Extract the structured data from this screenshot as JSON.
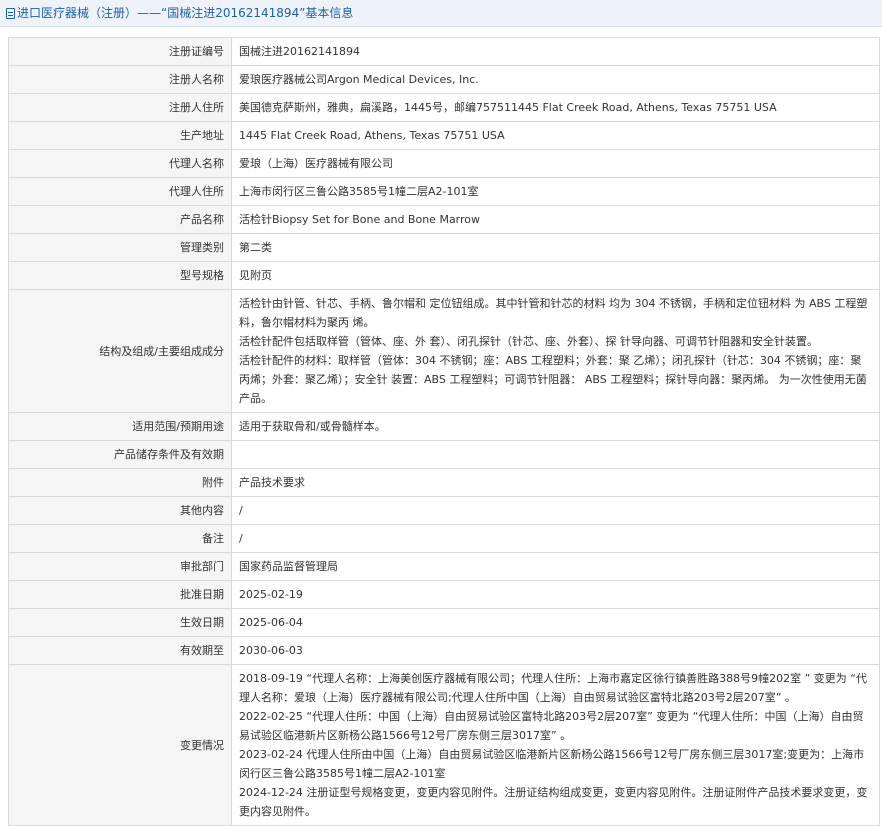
{
  "header": {
    "title": "进口医疗器械（注册）——“国械注进20162141894”基本信息"
  },
  "fields": [
    {
      "label": "注册证编号",
      "value": "国械注进20162141894"
    },
    {
      "label": "注册人名称",
      "value": "爱琅医疗器械公司Argon Medical Devices, Inc."
    },
    {
      "label": "注册人住所",
      "value": "美国德克萨斯州，雅典，扁溪路，1445号，邮编757511445 Flat Creek Road, Athens, Texas 75751 USA"
    },
    {
      "label": "生产地址",
      "value": "1445 Flat Creek Road, Athens, Texas 75751 USA"
    },
    {
      "label": "代理人名称",
      "value": "爱琅（上海）医疗器械有限公司"
    },
    {
      "label": "代理人住所",
      "value": "上海市闵行区三鲁公路3585号1幢二层A2-101室"
    },
    {
      "label": "产品名称",
      "value": "活检针Biopsy Set for Bone and Bone Marrow"
    },
    {
      "label": "管理类别",
      "value": "第二类"
    },
    {
      "label": "型号规格",
      "value": "见附页"
    }
  ],
  "structure": {
    "label": "结构及组成/主要组成成分",
    "lines": [
      "活检针由针管、针芯、手柄、鲁尔帽和 定位钮组成。其中针管和针芯的材料 均为 304 不锈钢，手柄和定位钮材料 为 ABS 工程塑料，鲁尔帽材料为聚丙 烯。",
      "活检针配件包括取样管（管体、座、外 套）、闭孔探针（针芯、座、外套）、探 针导向器、可调节针阻器和安全针装置。",
      "活检针配件的材料：取样管（管体：304 不锈钢；座：ABS 工程塑料；外套：聚 乙烯）；闭孔探针（针芯：304 不锈钢；座：聚丙烯；外套：聚乙烯）；安全针 装置：ABS 工程塑料；可调节针阻器： ABS 工程塑料；探针导向器：聚丙烯。 为一次性使用无菌产品。"
    ]
  },
  "fields2": [
    {
      "label": "适用范围/预期用途",
      "value": "适用于获取骨和/或骨髓样本。"
    },
    {
      "label": "产品储存条件及有效期",
      "value": ""
    },
    {
      "label": "附件",
      "value": "产品技术要求"
    },
    {
      "label": "其他内容",
      "value": "/"
    },
    {
      "label": "备注",
      "value": "/"
    },
    {
      "label": "审批部门",
      "value": "国家药品监督管理局"
    },
    {
      "label": "批准日期",
      "value": "2025-02-19"
    },
    {
      "label": "生效日期",
      "value": "2025-06-04"
    },
    {
      "label": "有效期至",
      "value": "2030-06-03"
    }
  ],
  "changes": {
    "label": "变更情况",
    "lines": [
      "2018-09-19 “代理人名称：上海美创医疗器械有限公司；代理人住所：上海市嘉定区徐行镇善胜路388号9幢202室 ” 变更为 “代理人名称：爱琅（上海）医疗器械有限公司;代理人住所中国（上海）自由贸易试验区富特北路203号2层207室” 。",
      "2022-02-25 “代理人住所：中国（上海）自由贸易试验区富特北路203号2层207室” 变更为 “代理人住所：中国（上海）自由贸易试验区临港新片区新杨公路1566号12号厂房东侧三层3017室” 。",
      "2023-02-24 代理人住所由中国（上海）自由贸易试验区临港新片区新杨公路1566号12号厂房东侧三层3017室;变更为：上海市闵行区三鲁公路3585号1幢二层A2-101室",
      "2024-12-24 注册证型号规格变更，变更内容见附件。注册证结构组成变更，变更内容见附件。注册证附件产品技术要求变更，变更内容见附件。"
    ]
  }
}
